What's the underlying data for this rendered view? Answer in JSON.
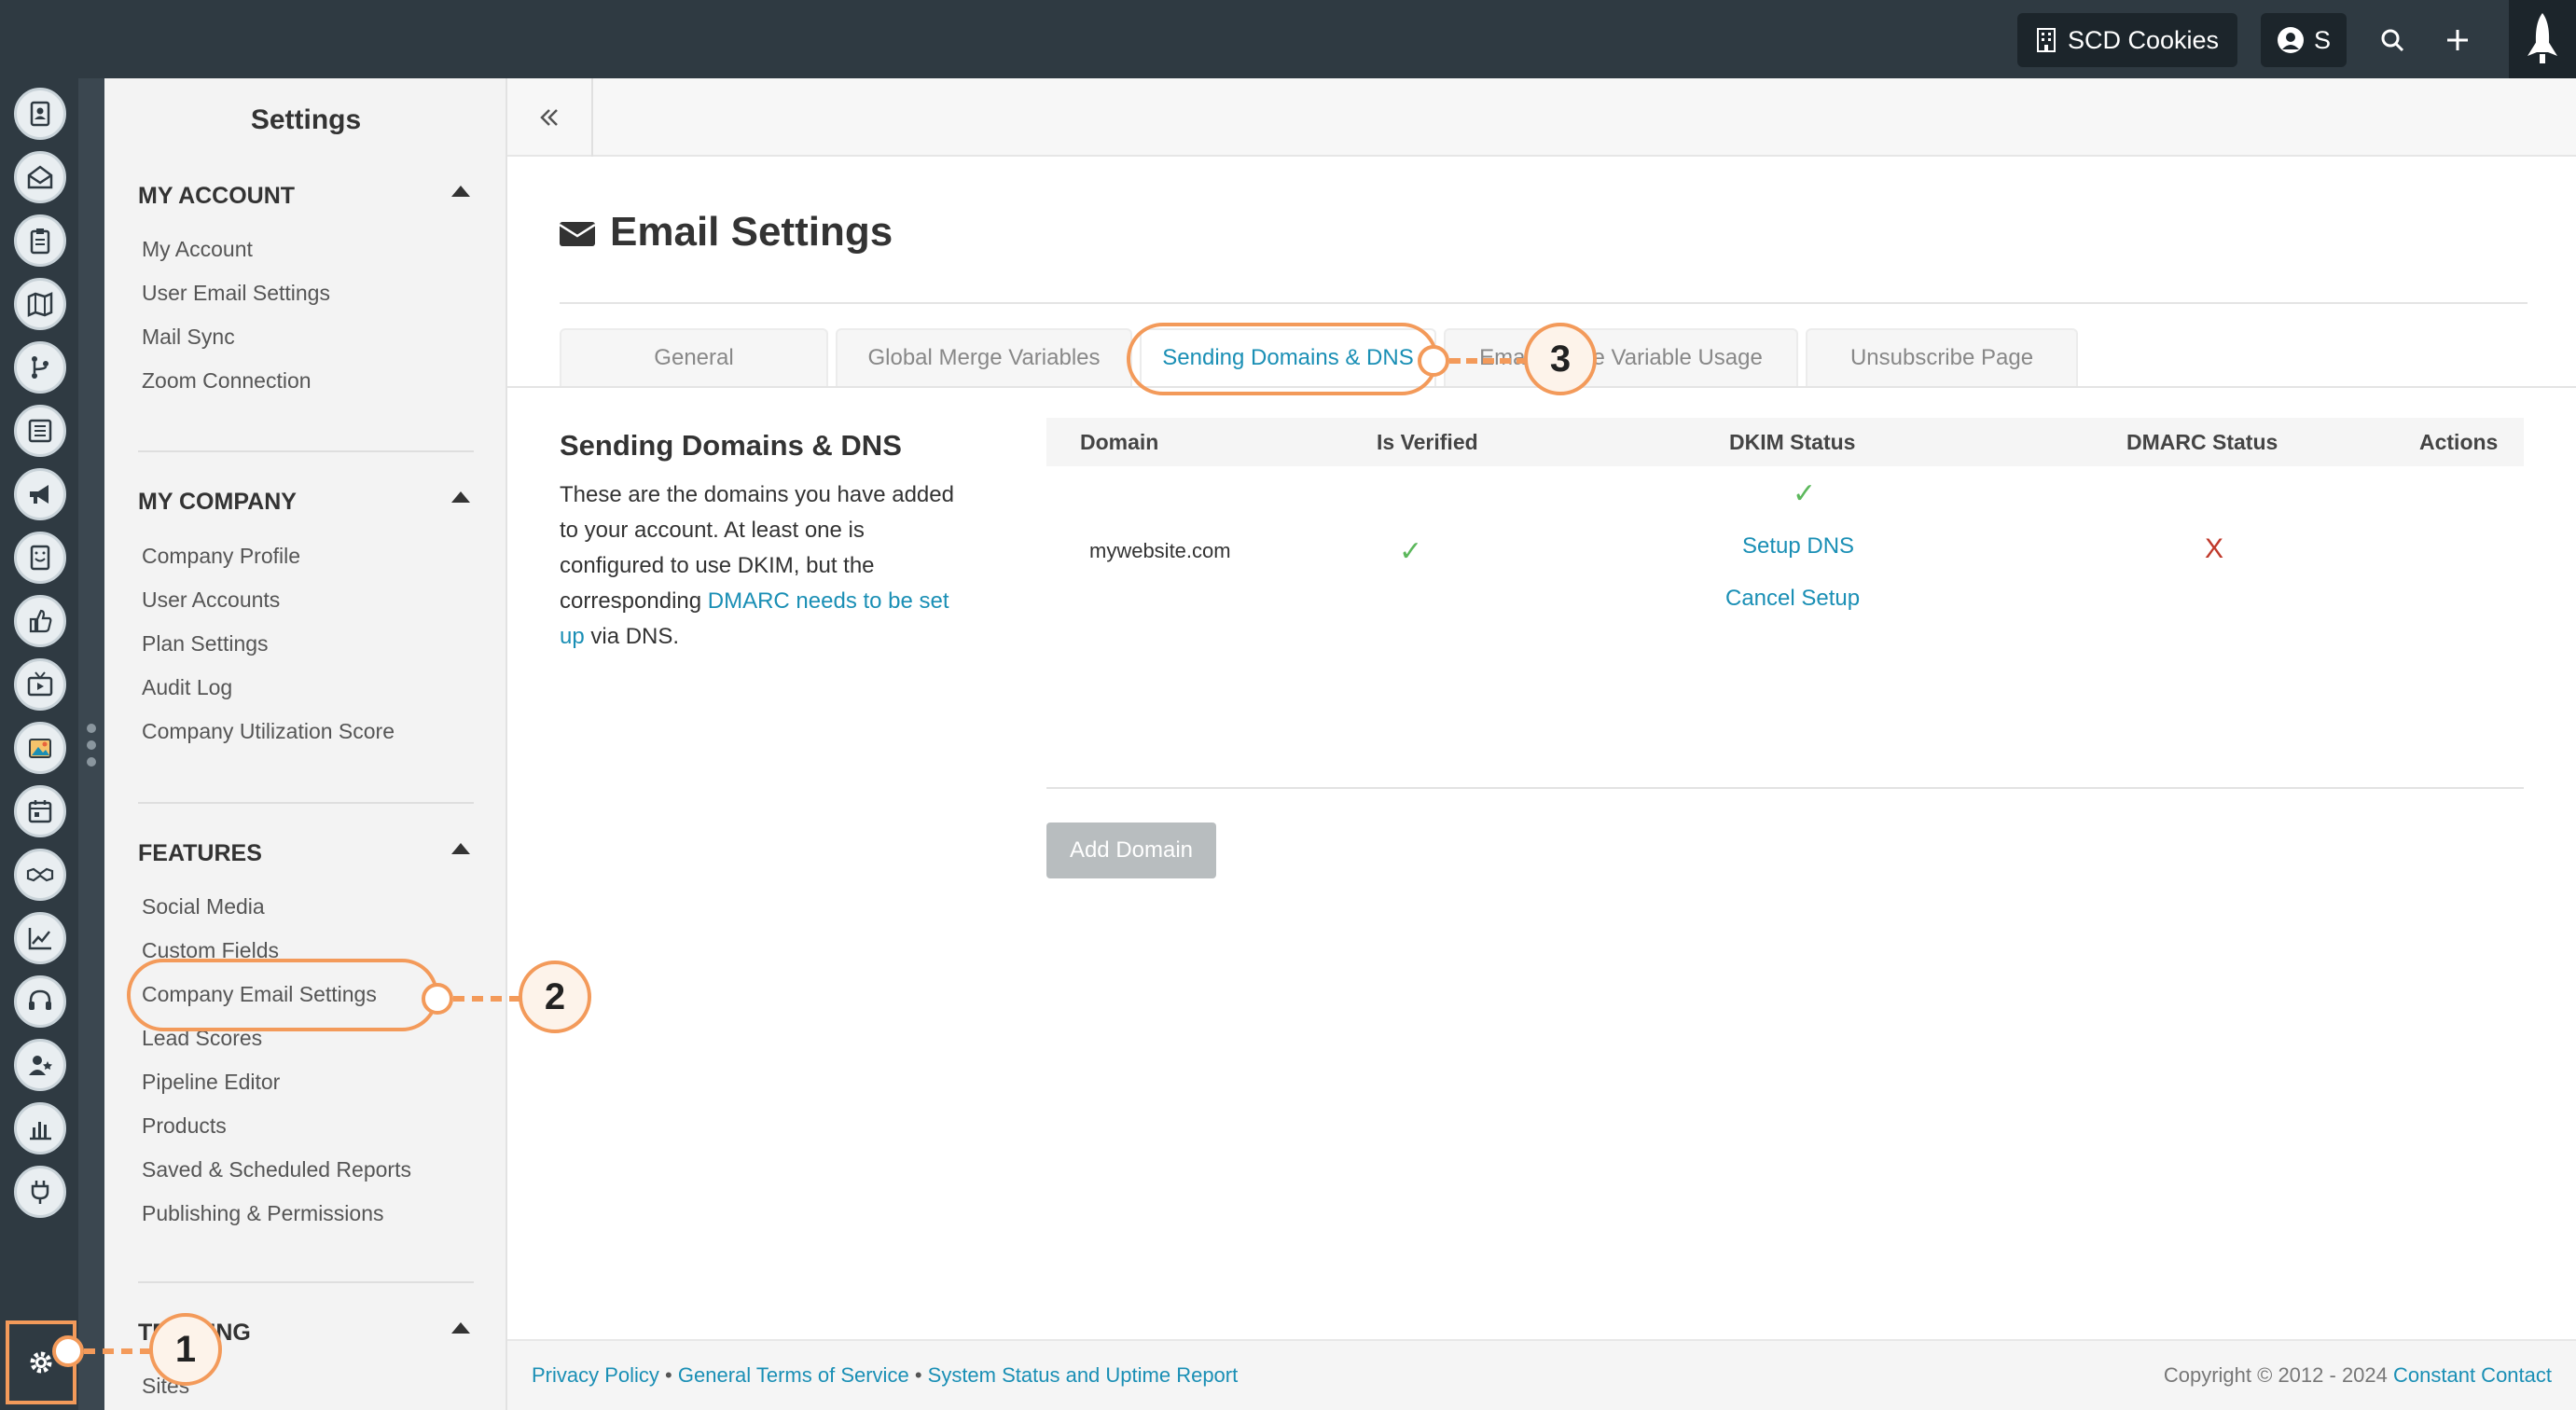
{
  "topbar": {
    "company": "SCD Cookies",
    "user_initial": "S"
  },
  "sidebar": {
    "title": "Settings",
    "sections": [
      {
        "title": "MY ACCOUNT",
        "items": [
          "My Account",
          "User Email Settings",
          "Mail Sync",
          "Zoom Connection"
        ]
      },
      {
        "title": "MY COMPANY",
        "items": [
          "Company Profile",
          "User Accounts",
          "Plan Settings",
          "Audit Log",
          "Company Utilization Score"
        ]
      },
      {
        "title": "FEATURES",
        "items": [
          "Social Media",
          "Custom Fields",
          "Company Email Settings",
          "Lead Scores",
          "Pipeline Editor",
          "Products",
          "Saved & Scheduled Reports",
          "Publishing & Permissions"
        ]
      },
      {
        "title": "TRAINING",
        "items": [
          "Sites"
        ]
      }
    ]
  },
  "page": {
    "title": "Email Settings",
    "tabs": [
      "General",
      "Global Merge Variables",
      "Sending Domains & DNS",
      "Email Merge Variable Usage",
      "Unsubscribe Page"
    ],
    "active_tab": "Sending Domains & DNS"
  },
  "description": {
    "title": "Sending Domains & DNS",
    "text_before": "These are the domains you have added to your account. At least one is configured to use DKIM, but the corresponding ",
    "link": "DMARC needs to be set up",
    "text_after": " via DNS."
  },
  "table": {
    "headers": [
      "Domain",
      "Is Verified",
      "DKIM Status",
      "DMARC Status",
      "Actions"
    ],
    "rows": [
      {
        "domain": "mywebsite.com",
        "is_verified": "✓",
        "dkim_check": "✓",
        "dkim_setup": "Setup DNS",
        "dkim_cancel": "Cancel Setup",
        "dmarc_status": "X"
      }
    ],
    "add_button": "Add Domain"
  },
  "footer": {
    "links": [
      "Privacy Policy",
      "General Terms of Service",
      "System Status and Uptime Report"
    ],
    "separator": "•",
    "copyright": "Copyright © 2012 - 2024",
    "brand": "Constant Contact"
  },
  "callouts": [
    "1",
    "2",
    "3"
  ],
  "colors": {
    "topbar": "#2f3a42",
    "accent_link": "#1a8fb5",
    "callout": "#f39a5a",
    "check": "#5cb85c",
    "error": "#c0392b"
  }
}
